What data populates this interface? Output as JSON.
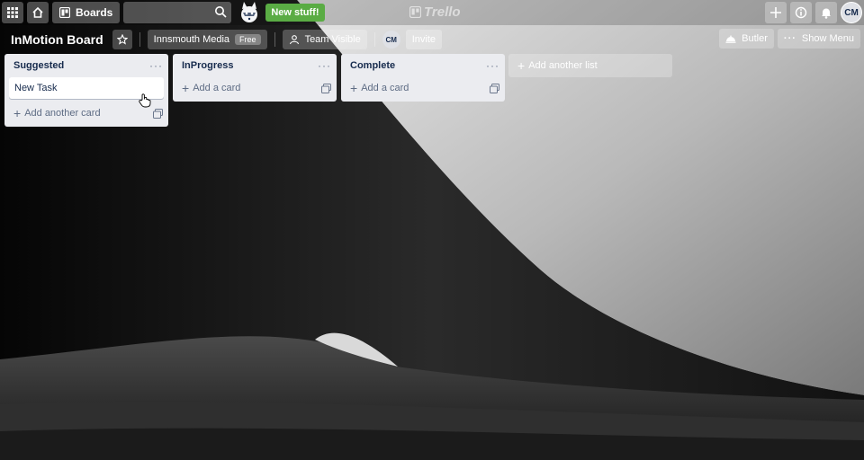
{
  "header": {
    "boards_label": "Boards",
    "new_stuff_label": "New stuff!",
    "logo_text": "Trello",
    "user_initials": "CM"
  },
  "board": {
    "title": "InMotion Board",
    "team_name": "Innsmouth Media",
    "team_badge": "Free",
    "visibility_label": "Team Visible",
    "member_initials": "CM",
    "invite_label": "Invite",
    "butler_label": "Butler",
    "show_menu_label": "Show Menu"
  },
  "lists": [
    {
      "title": "Suggested",
      "cards": [
        "New Task"
      ],
      "add_label": "Add another card"
    },
    {
      "title": "InProgress",
      "cards": [],
      "add_label": "Add a card"
    },
    {
      "title": "Complete",
      "cards": [],
      "add_label": "Add a card"
    }
  ],
  "add_list_label": "Add another list",
  "colors": {
    "list_bg": "#ebecf0",
    "new_stuff_green": "#5aac44",
    "text_dark": "#172b4d"
  }
}
